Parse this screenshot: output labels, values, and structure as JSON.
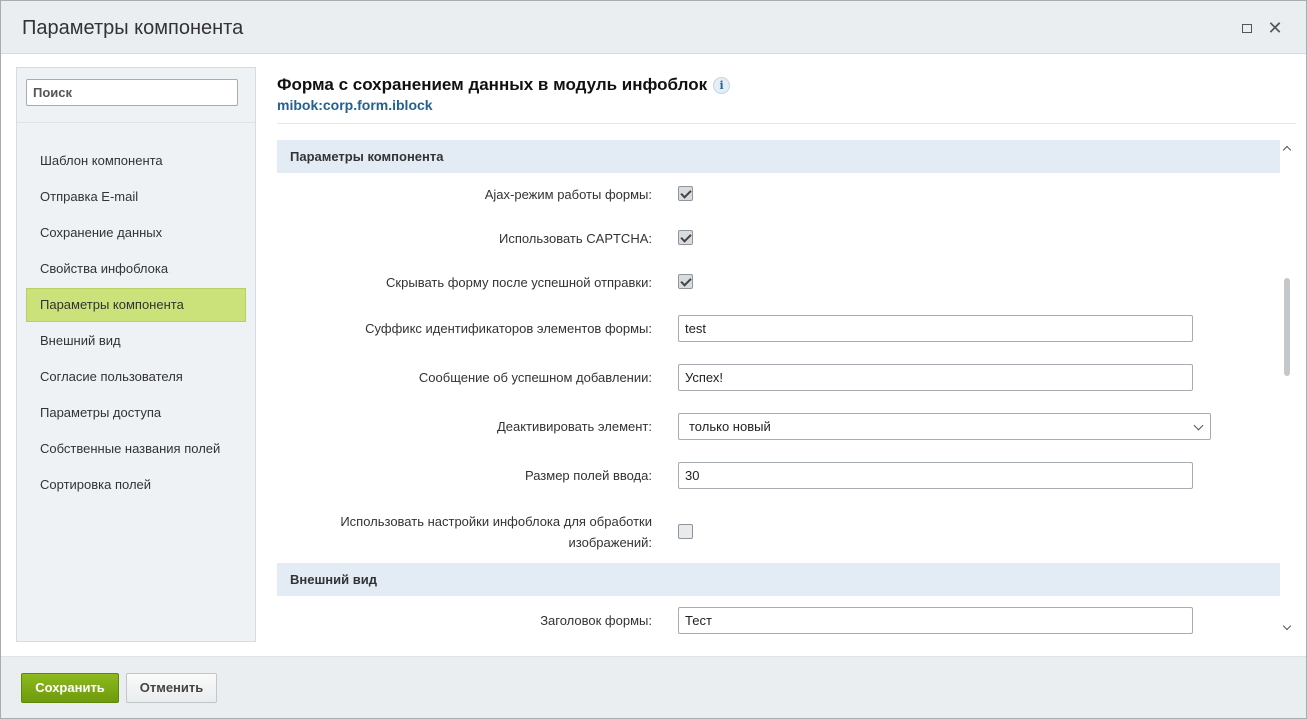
{
  "header": {
    "title": "Параметры компонента"
  },
  "search": {
    "placeholder": "Поиск"
  },
  "sidebar": {
    "items": [
      {
        "label": "Шаблон компонента"
      },
      {
        "label": "Отправка E-mail"
      },
      {
        "label": "Сохранение данных"
      },
      {
        "label": "Свойства инфоблока"
      },
      {
        "label": "Параметры компонента",
        "active": true
      },
      {
        "label": "Внешний вид"
      },
      {
        "label": "Согласие пользователя"
      },
      {
        "label": "Параметры доступа"
      },
      {
        "label": "Собственные названия полей"
      },
      {
        "label": "Сортировка полей"
      }
    ]
  },
  "main": {
    "title": "Форма с сохранением данных в модуль инфоблок",
    "info_glyph": "i",
    "component_code": "mibok:corp.form.iblock",
    "sections": [
      {
        "title": "Параметры компонента",
        "fields": [
          {
            "label": "Ajax-режим работы формы:",
            "type": "checkbox",
            "checked": true
          },
          {
            "label": "Использовать CAPTCHA:",
            "type": "checkbox",
            "checked": true
          },
          {
            "label": "Скрывать форму после успешной отправки:",
            "type": "checkbox",
            "checked": true
          },
          {
            "label": "Суффикс идентификаторов элементов формы:",
            "type": "text",
            "value": "test"
          },
          {
            "label": "Сообщение об успешном добавлении:",
            "type": "text",
            "value": "Успех!"
          },
          {
            "label": "Деактивировать элемент:",
            "type": "select",
            "value": "только новый"
          },
          {
            "label": "Размер полей ввода:",
            "type": "text",
            "value": "30"
          },
          {
            "label_line1": "Использовать настройки инфоблока для обработки",
            "label_line2": "изображений:",
            "type": "checkbox",
            "checked": false
          }
        ]
      },
      {
        "title": "Внешний вид",
        "fields": [
          {
            "label": "Заголовок формы:",
            "type": "text",
            "value": "Тест"
          }
        ]
      }
    ]
  },
  "footer": {
    "save_label": "Сохранить",
    "cancel_label": "Отменить"
  },
  "colors": {
    "accent_green": "#7aaa14",
    "active_item": "#cbe17a",
    "section_bg": "#e3ecf4",
    "link_blue": "#236191"
  },
  "icons": {
    "maximize": "maximize-icon",
    "close": "close-icon",
    "info": "info-icon",
    "scroll_up": "chevron-up-icon",
    "scroll_down": "chevron-down-icon",
    "select": "chevron-down-icon"
  }
}
